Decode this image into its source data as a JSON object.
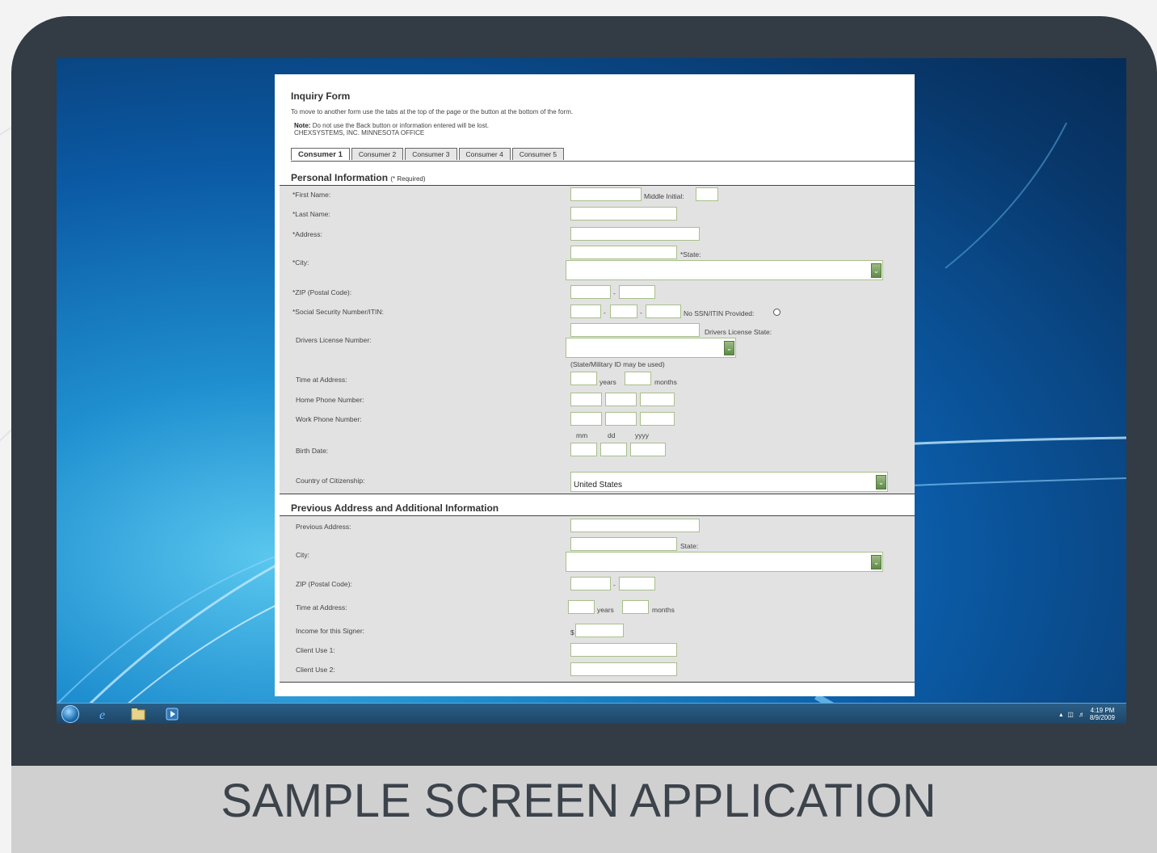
{
  "form": {
    "title": "Inquiry Form",
    "instructions": "To move to another form use the tabs at the top of the page or the button at the bottom of the form.",
    "note_label": "Note:",
    "note_text": "Do not use the Back button or information entered will be lost.",
    "office": "CHEXSYSTEMS, INC. MINNESOTA OFFICE",
    "tabs": [
      {
        "label": "Consumer 1",
        "active": true
      },
      {
        "label": "Consumer 2",
        "active": false
      },
      {
        "label": "Consumer 3",
        "active": false
      },
      {
        "label": "Consumer 4",
        "active": false
      },
      {
        "label": "Consumer 5",
        "active": false
      }
    ]
  },
  "personal": {
    "title": "Personal Information",
    "required_note": "(* Required)",
    "first_name": "*First Name:",
    "middle_initial": "Middle Initial:",
    "last_name": "*Last Name:",
    "address": "*Address:",
    "city": "*City:",
    "state": "*State:",
    "zip": "*ZIP (Postal Code):",
    "dash": "-",
    "ssn": "*Social Security Number/ITIN:",
    "no_ssn": "No SSN/ITIN Provided:",
    "dl_number": "Drivers License Number:",
    "dl_state": "Drivers License State:",
    "dl_hint": "(State/Military ID may be used)",
    "time_at_address": "Time at Address:",
    "years": "years",
    "months": "months",
    "home_phone": "Home Phone Number:",
    "work_phone": "Work Phone Number:",
    "mm": "mm",
    "dd": "dd",
    "yyyy": "yyyy",
    "birth_date": "Birth Date:",
    "country": "Country of Citizenship:",
    "country_value": "United States"
  },
  "previous": {
    "title": "Previous Address and Additional Information",
    "prev_address": "Previous Address:",
    "city": "City:",
    "state": "State:",
    "zip": "ZIP (Postal Code):",
    "time_at_address": "Time at Address:",
    "years": "years",
    "months": "months",
    "income": "Income for this Signer:",
    "currency": "$",
    "client_use_1": "Client Use 1:",
    "client_use_2": "Client Use 2:"
  },
  "taskbar": {
    "time": "4:19 PM",
    "date": "8/9/2009",
    "icons": [
      "start-orb",
      "internet-explorer-icon",
      "folder-icon",
      "media-player-icon"
    ]
  },
  "footer": {
    "caption": "SAMPLE SCREEN APPLICATION"
  },
  "colors": {
    "device": "#333b44",
    "footer": "#d0d0d1",
    "field_border": "#a8c08a",
    "section_bg": "#e2e2e2"
  }
}
